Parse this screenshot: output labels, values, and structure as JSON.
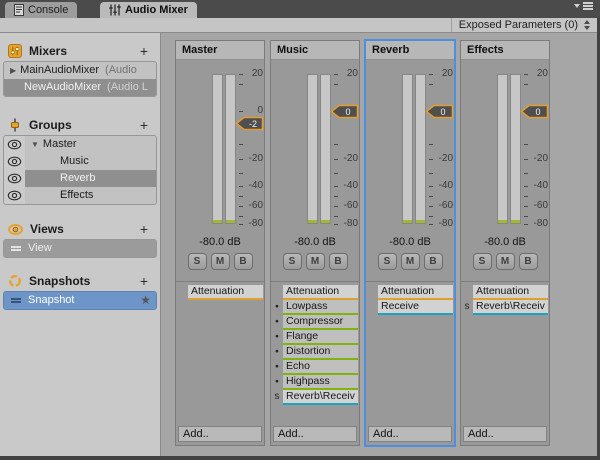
{
  "window": {
    "tabs": [
      {
        "label": "Console"
      },
      {
        "label": "Audio Mixer"
      }
    ],
    "toolbar": {
      "exposed_parameters": "Exposed Parameters (0)"
    }
  },
  "sidebar": {
    "mixers": {
      "title": "Mixers",
      "add_button": "+",
      "items": [
        {
          "label": "MainAudioMixer",
          "suffix": "(Audio"
        },
        {
          "label": "NewAudioMixer",
          "suffix": "(Audio L",
          "selected": true
        }
      ]
    },
    "groups": {
      "title": "Groups",
      "add_button": "+",
      "items": [
        {
          "label": "Master"
        },
        {
          "label": "Music"
        },
        {
          "label": "Reverb",
          "selected": true
        },
        {
          "label": "Effects"
        }
      ]
    },
    "views": {
      "title": "Views",
      "add_button": "+",
      "items": [
        {
          "label": "View"
        }
      ]
    },
    "snapshots": {
      "title": "Snapshots",
      "add_button": "+",
      "items": [
        {
          "label": "Snapshot",
          "starred": true
        }
      ]
    }
  },
  "meter_scale": {
    "labels": [
      "20",
      "0",
      "-20",
      "-40",
      "-60",
      "-80"
    ]
  },
  "common": {
    "db_readout": "-80.0 dB",
    "solo": "S",
    "mute": "M",
    "bypass": "B",
    "add_button": "Add.."
  },
  "strips": [
    {
      "name": "Master",
      "fader_value": "-2",
      "effects": [
        {
          "prefix": "",
          "label": "Attenuation",
          "color": "orange"
        }
      ]
    },
    {
      "name": "Music",
      "fader_value": "0",
      "effects": [
        {
          "prefix": "",
          "label": "Attenuation",
          "color": "orange"
        },
        {
          "prefix": "●",
          "label": "Lowpass",
          "color": "green"
        },
        {
          "prefix": "●",
          "label": "Compressor",
          "color": "green"
        },
        {
          "prefix": "●",
          "label": "Flange",
          "color": "green"
        },
        {
          "prefix": "●",
          "label": "Distortion",
          "color": "green"
        },
        {
          "prefix": "●",
          "label": "Echo",
          "color": "green"
        },
        {
          "prefix": "●",
          "label": "Highpass",
          "color": "green"
        },
        {
          "prefix": "s",
          "label": "Reverb\\Receiv",
          "color": "cyan"
        }
      ]
    },
    {
      "name": "Reverb",
      "fader_value": "0",
      "selected": true,
      "effects": [
        {
          "prefix": "",
          "label": "Attenuation",
          "color": "orange"
        },
        {
          "prefix": "",
          "label": "Receive",
          "color": "cyan"
        }
      ]
    },
    {
      "name": "Effects",
      "fader_value": "0",
      "effects": [
        {
          "prefix": "",
          "label": "Attenuation",
          "color": "orange"
        },
        {
          "prefix": "s",
          "label": "Reverb\\Receiv",
          "color": "cyan"
        }
      ]
    }
  ],
  "colors": {
    "accent_orange": "#E0A030",
    "effect_green": "#82B30D",
    "send_cyan": "#19A5BC",
    "selection_blue": "#6E95C8",
    "strip_highlight_blue": "#4E8FDB"
  }
}
